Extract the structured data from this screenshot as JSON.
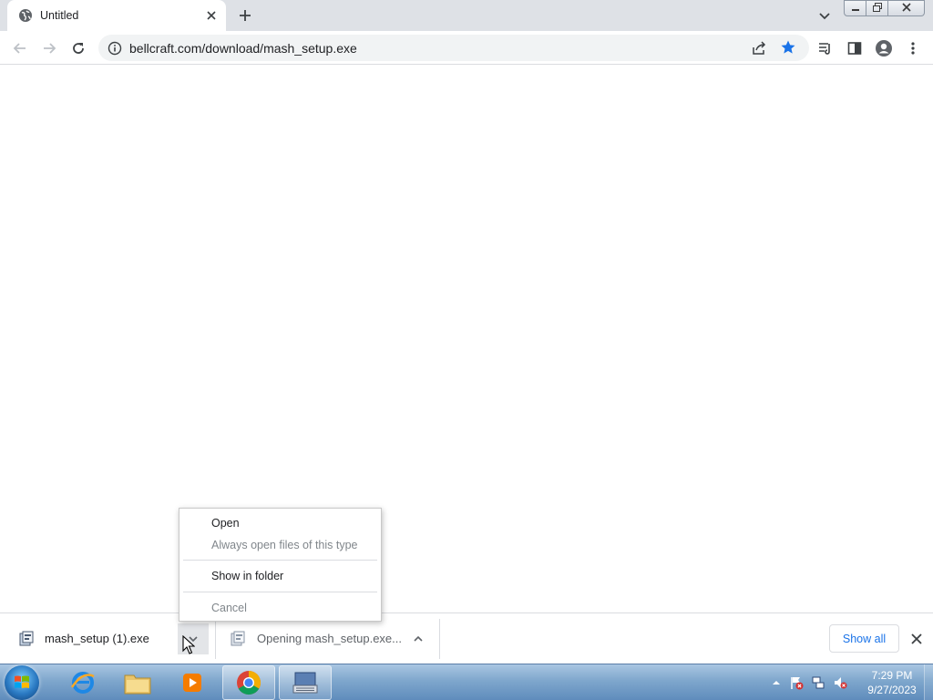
{
  "browser": {
    "tab": {
      "title": "Untitled"
    },
    "url": "bellcraft.com/download/mash_setup.exe"
  },
  "context_menu": {
    "items": [
      {
        "label": "Open",
        "enabled": true
      },
      {
        "label": "Always open files of this type",
        "enabled": false
      },
      {
        "label": "Show in folder",
        "enabled": true
      },
      {
        "label": "Cancel",
        "enabled": false
      }
    ]
  },
  "download_shelf": {
    "items": [
      {
        "filename": "mash_setup (1).exe"
      },
      {
        "filename": "Opening mash_setup.exe..."
      }
    ],
    "show_all_label": "Show all"
  },
  "taskbar": {
    "apps": [
      "internet-explorer",
      "windows-explorer",
      "media-player",
      "chrome",
      "on-screen-keyboard"
    ],
    "clock": {
      "time": "7:29 PM",
      "date": "9/27/2023"
    }
  },
  "colors": {
    "accent": "#1a73e8",
    "star": "#1a73e8",
    "tabstrip": "#dee1e6"
  }
}
